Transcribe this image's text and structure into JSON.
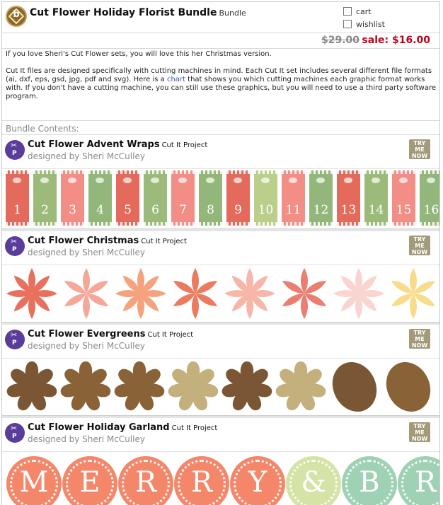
{
  "product": {
    "title": "Cut Flower Holiday Florist Bundle",
    "type": "Bundle",
    "cart_label": "cart",
    "wishlist_label": "wishlist",
    "old_price": "$29.00",
    "sale_price": "sale: $16.00",
    "logo_letter": "b"
  },
  "description": {
    "p1": "If you love Sheri's Cut Flower sets, you will love this her Christmas version.",
    "p2_before": "Cut It files are designed specifically with cutting machines in mind. Each Cut It set includes several different file formats (ai, dxf, eps, gsd, jpg, pdf and svg). Here is a ",
    "p2_link": "chart",
    "p2_after": " that shows you which cutting machines each graphic format works with. If you don't have a cutting machine, you can still use these graphics, but you will need to use a third party software program."
  },
  "bundle_contents_label": "Bundle Contents:",
  "try_label": "TRY ME NOW",
  "items": [
    {
      "name": "Cut Flower Advent Wraps",
      "type": "Cut It Project",
      "designer": "designed by Sheri McCulley"
    },
    {
      "name": "Cut Flower Christmas",
      "type": "Cut It Project",
      "designer": "designed by Sheri McCulley"
    },
    {
      "name": "Cut Flower Evergreens",
      "type": "Cut It Project",
      "designer": "designed by Sheri McCulley"
    },
    {
      "name": "Cut Flower Holiday Garland",
      "type": "Cut It Project",
      "designer": "designed by Sheri McCulley"
    }
  ],
  "advent_numbers": [
    "1",
    "2",
    "3",
    "4",
    "5",
    "6",
    "7",
    "8",
    "9",
    "10",
    "11",
    "12",
    "13",
    "14",
    "15",
    "16"
  ],
  "advent_colors": [
    "#e46b5c",
    "#9cbb7a",
    "#f28e86",
    "#93b77a",
    "#e46b5c",
    "#9cbb7a",
    "#f28e86",
    "#93b77a",
    "#e46b5c",
    "#b9cf8a",
    "#f28e86",
    "#93b77a",
    "#e46b5c",
    "#9cbb7a",
    "#f28e86",
    "#93b77a"
  ],
  "christmas_flower_colors": [
    "#e8705e",
    "#f5a89a",
    "#f4a37e",
    "#ec7a5e",
    "#f7b7a8",
    "#ec7d70",
    "#fad4d0",
    "#f8dc8c"
  ],
  "evergreen_colors": [
    "#7a5634",
    "#8a6238",
    "#8a6238",
    "#c4b07c",
    "#7a5634",
    "#c4b07c",
    "#7a5634",
    "#8a6238"
  ],
  "garland_letters": [
    "M",
    "E",
    "R",
    "R",
    "Y",
    "&",
    "B",
    "R"
  ],
  "garland_colors": [
    "#f4876a",
    "#f4876a",
    "#f4876a",
    "#f4876a",
    "#f4876a",
    "#d5e3a6",
    "#9fd2b4",
    "#9fd2b4"
  ]
}
